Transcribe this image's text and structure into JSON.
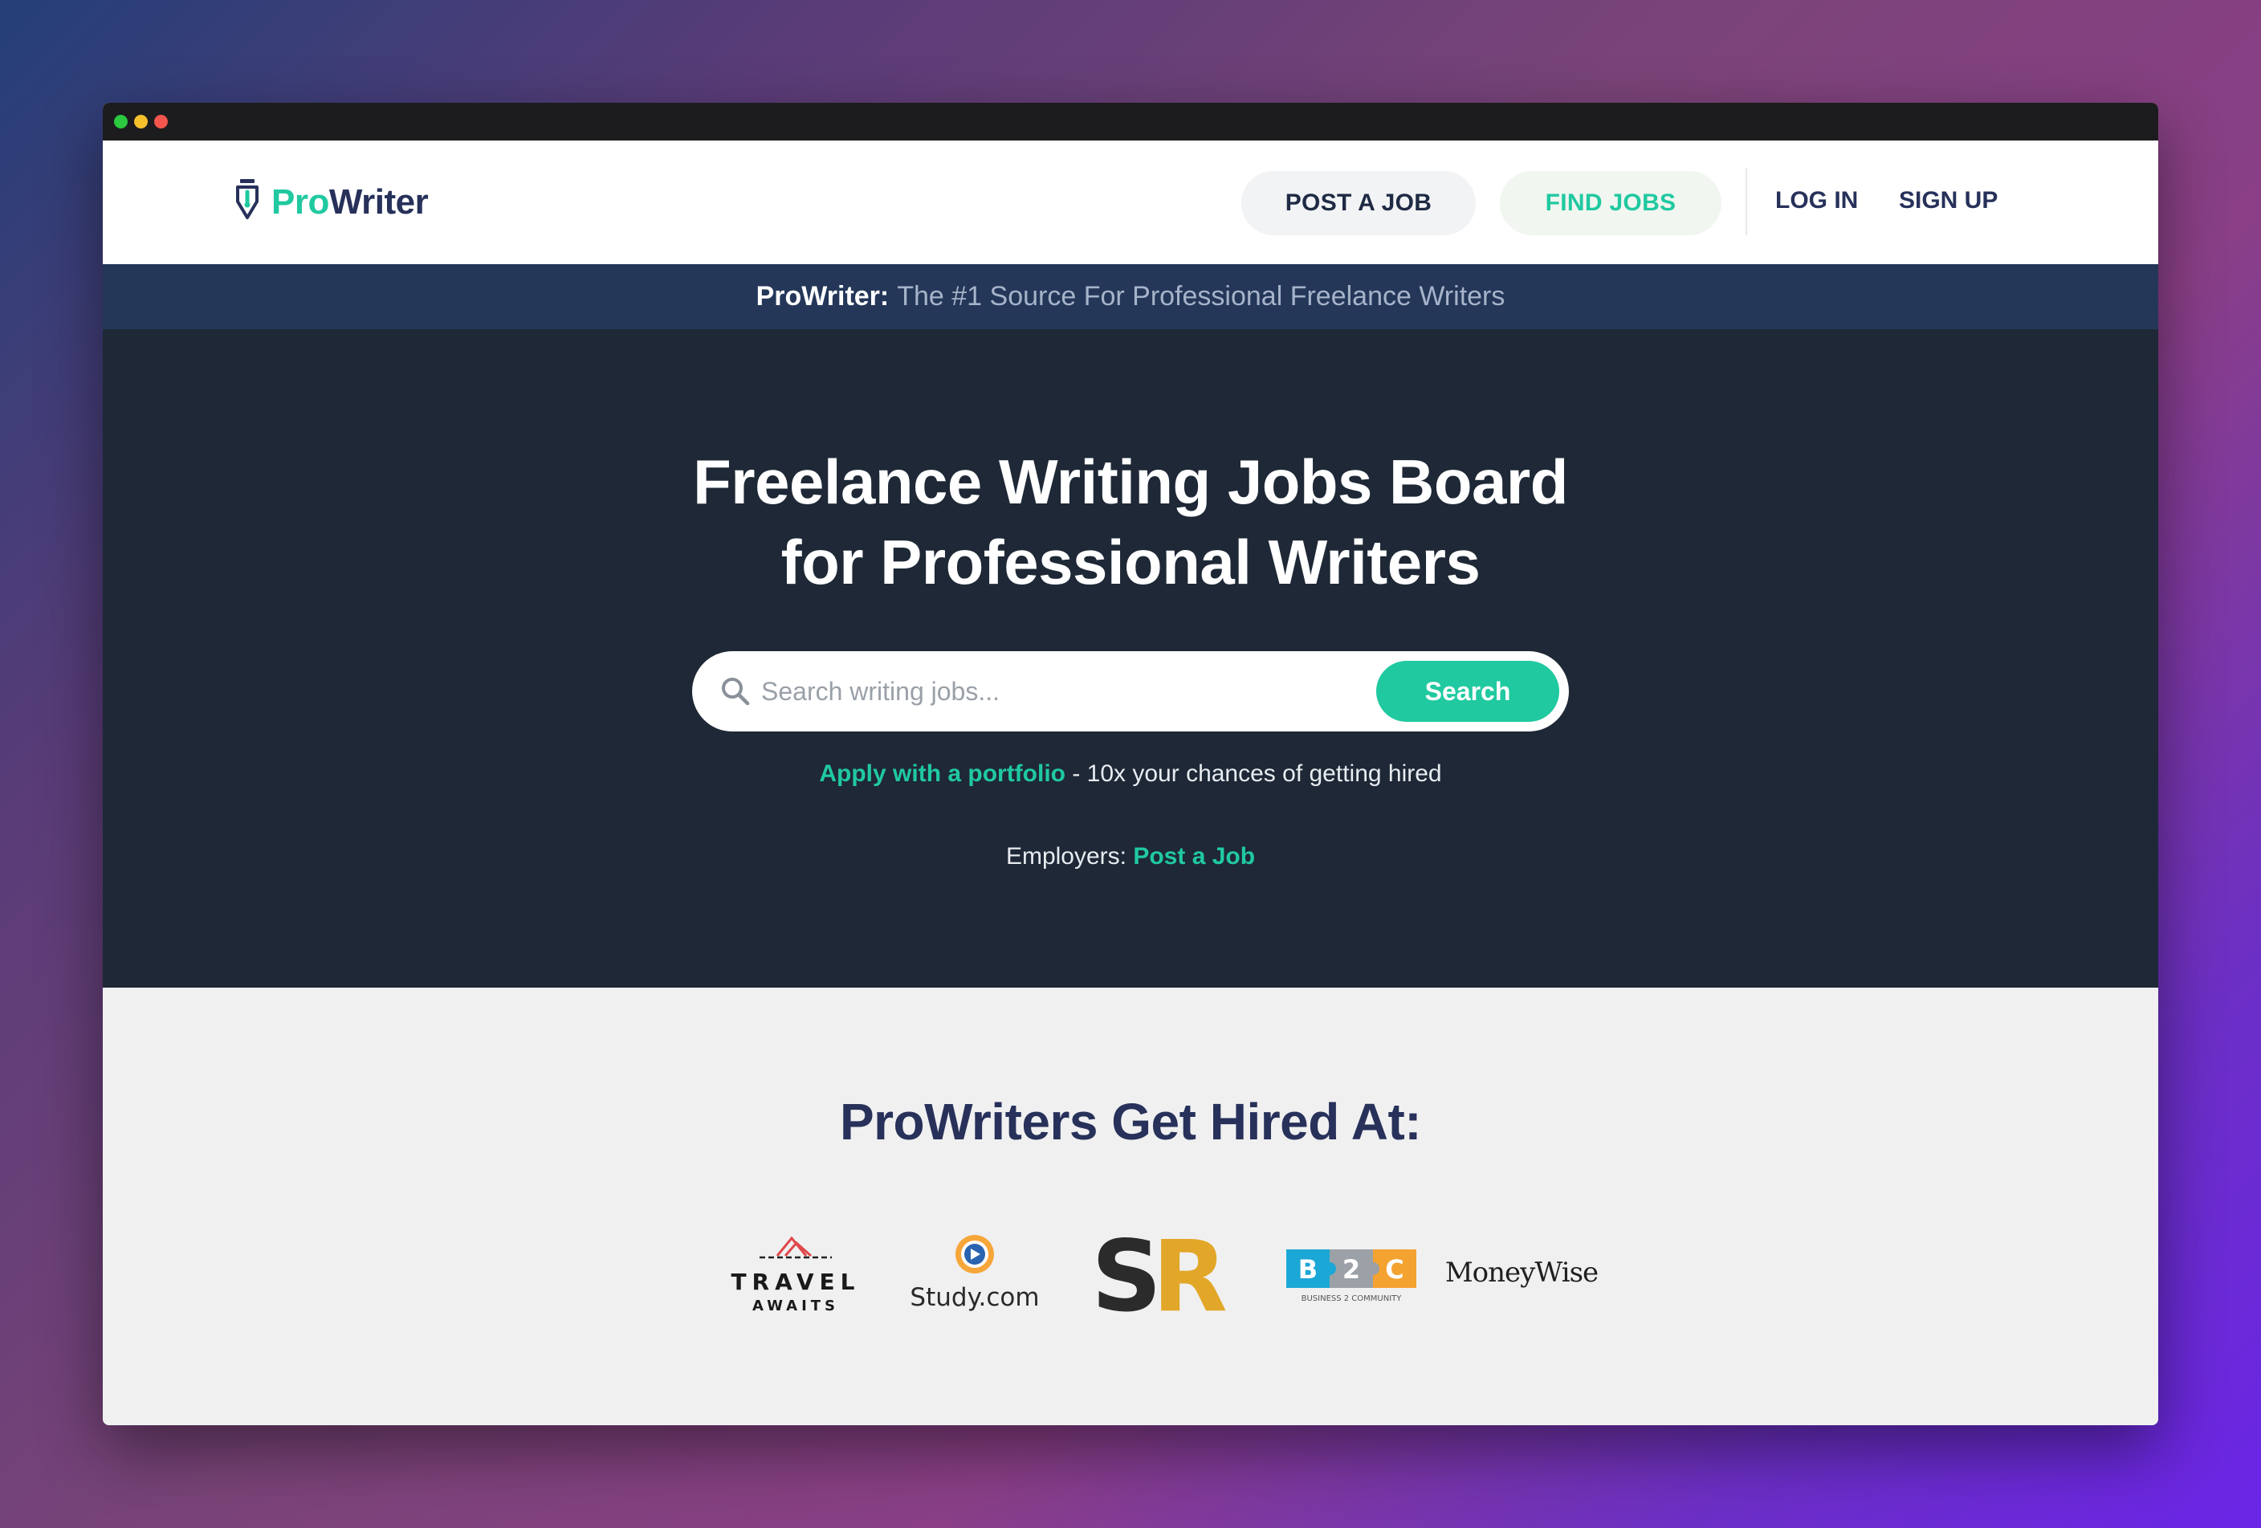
{
  "window": {
    "controls": [
      "green",
      "yellow",
      "red"
    ]
  },
  "navbar": {
    "logo_pro": "Pro",
    "logo_writer": "Writer",
    "post_job_label": "POST A JOB",
    "find_jobs_label": "FIND JOBS",
    "login_label": "LOG IN",
    "signup_label": "SIGN UP"
  },
  "tagline": {
    "brand": "ProWriter:",
    "text": "The #1 Source For Professional Freelance Writers"
  },
  "hero": {
    "title_line1": "Freelance Writing Jobs Board",
    "title_line2": "for Professional Writers",
    "search_placeholder": "Search writing jobs...",
    "search_value": "",
    "search_button_label": "Search",
    "portfolio_link": "Apply with a portfolio",
    "portfolio_rest": "- 10x your chances of getting hired",
    "employers_label": "Employers:",
    "post_job_link": "Post a Job"
  },
  "hired": {
    "title": "ProWriters Get Hired At:",
    "logos": [
      {
        "name": "Travel Awaits",
        "line1": "TRAVEL",
        "line2": "AWAITS"
      },
      {
        "name": "Study.com",
        "text": "Study.com"
      },
      {
        "name": "SR",
        "text": "SR"
      },
      {
        "name": "B2C",
        "letters": [
          "B",
          "2",
          "C"
        ],
        "sub": "BUSINESS 2 COMMUNITY"
      },
      {
        "name": "MoneyWise",
        "text": "MoneyWise"
      }
    ]
  },
  "colors": {
    "accent_green": "#20c9a0",
    "navy": "#27315a",
    "hero_bg": "#1e2836",
    "tagline_bg": "#243759"
  }
}
